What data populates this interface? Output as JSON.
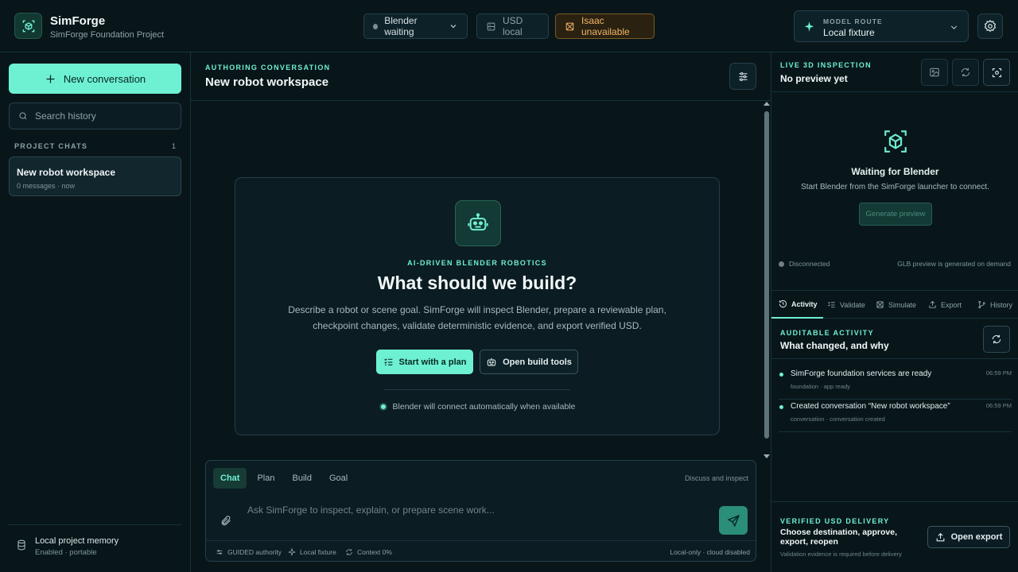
{
  "app": {
    "name": "SimForge",
    "project": "SimForge Foundation Project"
  },
  "status": {
    "blender": "Blender waiting",
    "usd": "USD local",
    "isaac": "Isaac unavailable"
  },
  "model_route": {
    "label": "MODEL ROUTE",
    "value": "Local fixture"
  },
  "sidebar": {
    "new_conversation": "New conversation",
    "search_placeholder": "Search history",
    "section_title": "PROJECT CHATS",
    "count": "1",
    "chats": [
      {
        "title": "New robot workspace",
        "meta": "0 messages · now"
      }
    ],
    "memory": {
      "title": "Local project memory",
      "subtitle": "Enabled · portable"
    }
  },
  "conversation": {
    "eyebrow": "AUTHORING CONVERSATION",
    "title": "New robot workspace"
  },
  "hero": {
    "eyebrow": "AI-DRIVEN BLENDER ROBOTICS",
    "title": "What should we build?",
    "description": "Describe a robot or scene goal. SimForge will inspect Blender, prepare a reviewable plan, checkpoint changes, validate deterministic evidence, and export verified USD.",
    "primary_button": "Start with a plan",
    "secondary_button": "Open build tools",
    "connect_note": "Blender will connect automatically when available"
  },
  "composer": {
    "tabs": [
      "Chat",
      "Plan",
      "Build",
      "Goal"
    ],
    "active_tab": "Chat",
    "hint": "Discuss and inspect",
    "placeholder": "Ask SimForge to inspect, explain, or prepare scene work...",
    "footer": {
      "authority": "GUIDED authority",
      "fixture": "Local fixture",
      "context": "Context 0%",
      "right": "Local-only · cloud disabled"
    }
  },
  "inspection": {
    "eyebrow": "LIVE 3D INSPECTION",
    "title": "No preview yet",
    "waiting_title": "Waiting for Blender",
    "waiting_sub": "Start Blender from the SimForge launcher to connect.",
    "generate": "Generate preview",
    "status": "Disconnected",
    "glb_note": "GLB preview is generated on demand"
  },
  "tabs": {
    "activity": "Activity",
    "validate": "Validate",
    "simulate": "Simulate",
    "export": "Export",
    "history": "History"
  },
  "activity": {
    "eyebrow": "AUDITABLE ACTIVITY",
    "title": "What changed, and why",
    "events": [
      {
        "title": "SimForge foundation services are ready",
        "meta": "foundation · app ready",
        "time": "06:59 PM"
      },
      {
        "title": "Created conversation “New robot workspace”",
        "meta": "conversation · conversation created",
        "time": "06:59 PM"
      }
    ]
  },
  "delivery": {
    "eyebrow": "VERIFIED USD DELIVERY",
    "title": "Choose destination, approve, export, reopen",
    "note": "Validation evidence is required before delivery",
    "button": "Open export"
  },
  "colors": {
    "accent": "#6ef0d2",
    "background": "#08161a",
    "warning": "#f3b56a"
  }
}
